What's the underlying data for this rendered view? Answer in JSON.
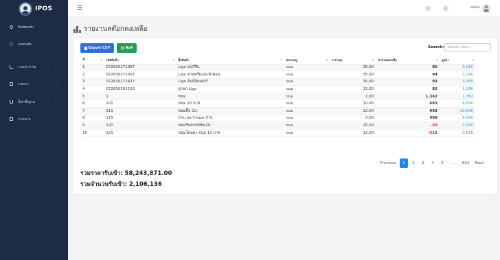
{
  "app": {
    "name": "IPOS"
  },
  "sidebar": {
    "items": [
      {
        "label": "ยินดีต้อนรับ",
        "icon": "check-circle-icon"
      },
      {
        "label": "แดชบอร์ด",
        "icon": "gear-icon"
      },
      {
        "label": "งานประจำวัน",
        "icon": "trend-icon"
      },
      {
        "label": "รายงาน",
        "icon": "document-icon"
      },
      {
        "label": "ตั้งค่าพื้นฐาน",
        "icon": "cart-icon"
      },
      {
        "label": "ระบบงาน",
        "icon": "book-icon"
      }
    ],
    "chevron": "›"
  },
  "topbar": {
    "user": "admin"
  },
  "page": {
    "title": "รายงานสต๊อกคงเหลือ"
  },
  "toolbar": {
    "csv_label": "Export CSV",
    "print_label": "พิมพ์",
    "search_label": "Search:",
    "search_placeholder": "Search here..."
  },
  "table": {
    "columns": [
      "#",
      "รหัสสินค้า",
      "ชื่อสินค้า",
      "หมวดหมู่",
      "ราคาทุน",
      "จำนวนคงเหลือ",
      "มูลค่า"
    ],
    "rows": [
      [
        "1",
        "072810271987",
        "Ligo ธญุรีจีน",
        "ขนม",
        "35.00",
        "86",
        "3,010"
      ],
      [
        "2",
        "072810272007",
        "Ligo ซาดครีมและหัวหอม",
        "ขนม",
        "35.00",
        "94",
        "3,290"
      ],
      [
        "3",
        "072810272427",
        "Ligo ฮันนี่บัตเตอร์",
        "ขนม",
        "35.00",
        "93",
        "3,255"
      ],
      [
        "4",
        "072810501152",
        "ลูกนก Ligo",
        "ขนม",
        "13.00",
        "82",
        "1,066"
      ],
      [
        "5",
        "1",
        "ขนม",
        "ขนม",
        "1.00",
        "1,362",
        "1,362"
      ],
      [
        "6",
        "101",
        "ขนม 10 บาท",
        "ขนม",
        "10.00",
        "683",
        "6,830"
      ],
      [
        "7",
        "111",
        "ขนมปี๊บ 12.-",
        "ขนม",
        "12.00",
        "903",
        "10,836"
      ],
      [
        "8",
        "115",
        "Chu pa Chups 5 B.",
        "ขนม",
        "5.00",
        "998",
        "4,990"
      ],
      [
        "9",
        "120",
        "ขนมรีบครกเทียม20.-",
        "ขนม",
        "20.00",
        "-50",
        "-1,000"
      ],
      [
        "10",
        "121",
        "ขนมโดนดง ขนม 12 บาท",
        "ขนม",
        "12.00",
        "-318",
        "-3,816"
      ]
    ]
  },
  "pagination": {
    "previous": "Previous",
    "pages": [
      "1",
      "2",
      "3",
      "4",
      "5",
      "...",
      "834"
    ],
    "next": "Next",
    "current": "1"
  },
  "totals": {
    "cost_total": "รวมราคารับเข้า: 58,243,871.00",
    "qty_total": "รวมจำนวนรับเข้า: 2,106,136"
  },
  "colors": {
    "sidebar": "#1e2b45",
    "primary": "#2f6fd8",
    "success": "#1f9d55",
    "value": "#1a9bd8",
    "negative": "#e02424"
  }
}
